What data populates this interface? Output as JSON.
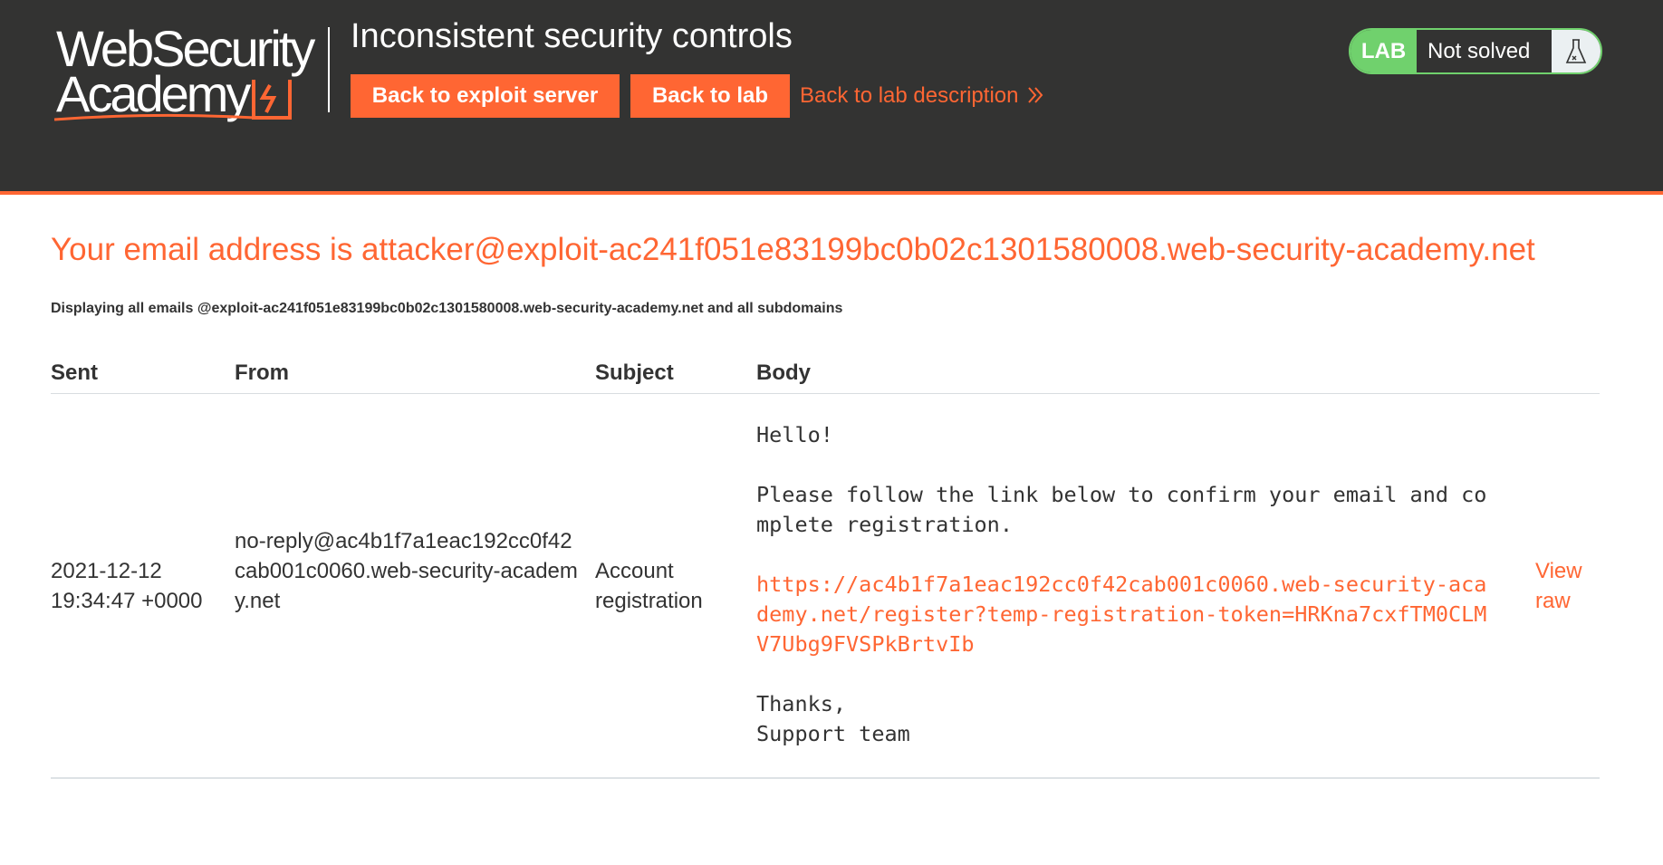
{
  "brand": {
    "logo_line1": "WebSecurity",
    "logo_line2": "Academy",
    "accent_color": "#ff6633"
  },
  "header": {
    "lab_title": "Inconsistent security controls",
    "exploit_button": "Back to exploit server",
    "lab_button": "Back to lab",
    "description_link": "Back to lab description",
    "status_badge": "LAB",
    "status_text": "Not solved",
    "status_color": "#70d16d"
  },
  "inbox": {
    "email_heading": "Your email address is attacker@exploit-ac241f051e83199bc0b02c1301580008.web-security-academy.net",
    "display_note": "Displaying all emails @exploit-ac241f051e83199bc0b02c1301580008.web-security-academy.net and all subdomains",
    "columns": [
      "Sent",
      "From",
      "Subject",
      "Body"
    ],
    "emails": [
      {
        "sent": "2021-12-12 19:34:47 +0000",
        "from": "no-reply@ac4b1f7a1eac192cc0f42cab001c0060.web-security-academy.net",
        "subject": "Account registration",
        "body_intro": "Hello!\n\nPlease follow the link below to confirm your email and co\nmplete registration.",
        "body_link": "https://ac4b1f7a1eac192cc0f42cab001c0060.web-security-aca\ndemy.net/register?temp-registration-token=HRKna7cxfTM0CLM\nV7Ubg9FVSPkBrtvIb",
        "body_signoff": "Thanks,\nSupport team",
        "view_raw": "View raw"
      }
    ]
  }
}
